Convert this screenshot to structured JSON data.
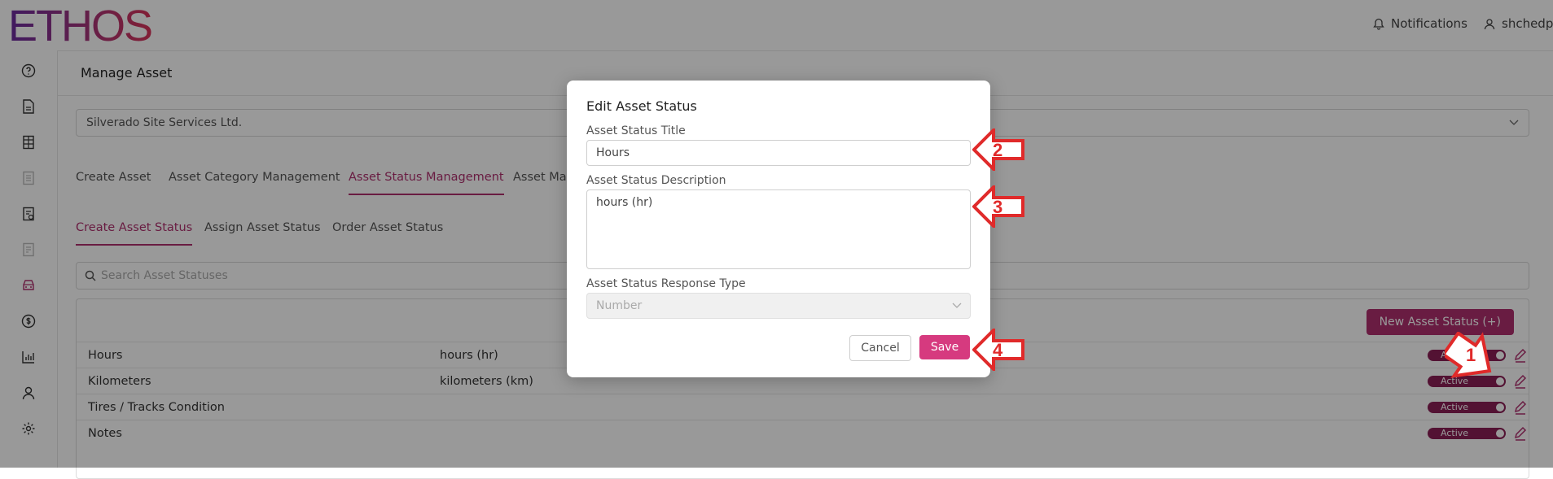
{
  "app": {
    "logo": "ETHOS"
  },
  "topnav": {
    "notifications": "Notifications",
    "user": "shchedp"
  },
  "page": {
    "title": "Manage Asset"
  },
  "company": {
    "selected": "Silverado Site Services Ltd."
  },
  "tabs": [
    {
      "label": "Create Asset"
    },
    {
      "label": "Asset Category Management"
    },
    {
      "label": "Asset Status Management"
    },
    {
      "label": "Asset Main"
    }
  ],
  "subtabs": [
    {
      "label": "Create Asset Status"
    },
    {
      "label": "Assign Asset Status"
    },
    {
      "label": "Order Asset Status"
    }
  ],
  "search": {
    "placeholder": "Search Asset Statuses"
  },
  "table": {
    "new_button": "New Asset Status (+)",
    "rows": [
      {
        "title": "Hours",
        "description": "hours (hr)",
        "status": "Active"
      },
      {
        "title": "Kilometers",
        "description": "kilometers (km)",
        "status": "Active"
      },
      {
        "title": "Tires / Tracks Condition",
        "description": "",
        "status": "Active"
      },
      {
        "title": "Notes",
        "description": "",
        "status": "Active"
      }
    ]
  },
  "modal": {
    "title": "Edit Asset Status",
    "title_label": "Asset Status Title",
    "title_value": "Hours",
    "description_label": "Asset Status Description",
    "description_value": "hours (hr)",
    "response_type_label": "Asset Status Response Type",
    "response_type_value": "Number",
    "cancel_label": "Cancel",
    "save_label": "Save"
  },
  "callouts": [
    "1",
    "2",
    "3",
    "4"
  ],
  "colors": {
    "accent": "#b0306e",
    "save": "#d63a7f",
    "callout": "#e02a2a"
  }
}
